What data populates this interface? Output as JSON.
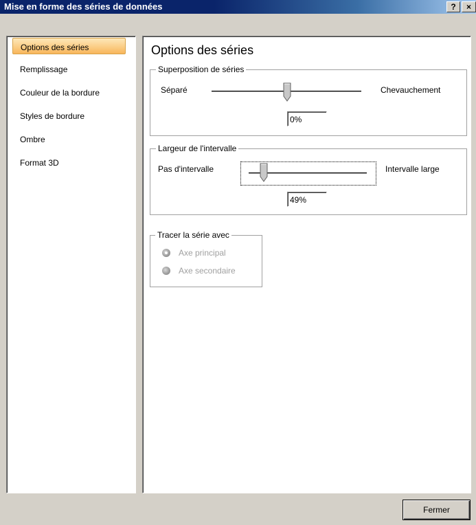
{
  "window": {
    "title": "Mise en forme des séries de données",
    "help_label": "?",
    "close_label": "×"
  },
  "sidebar": {
    "items": [
      {
        "label": "Options des séries",
        "selected": true
      },
      {
        "label": "Remplissage"
      },
      {
        "label": "Couleur de la bordure"
      },
      {
        "label": "Styles de bordure"
      },
      {
        "label": "Ombre"
      },
      {
        "label": "Format 3D"
      }
    ]
  },
  "main": {
    "heading": "Options des séries",
    "overlap": {
      "group_label": "Superposition de séries",
      "left_label": "Séparé",
      "right_label": "Chevauchement",
      "value": "0%"
    },
    "gap": {
      "group_label": "Largeur de l'intervalle",
      "left_label": "Pas d'intervalle",
      "right_label": "Intervalle large",
      "value": "49%"
    },
    "plot": {
      "group_label": "Tracer la série avec",
      "primary_label": "Axe principal",
      "secondary_label": "Axe secondaire",
      "selected": "primary"
    }
  },
  "footer": {
    "close_button": "Fermer"
  }
}
